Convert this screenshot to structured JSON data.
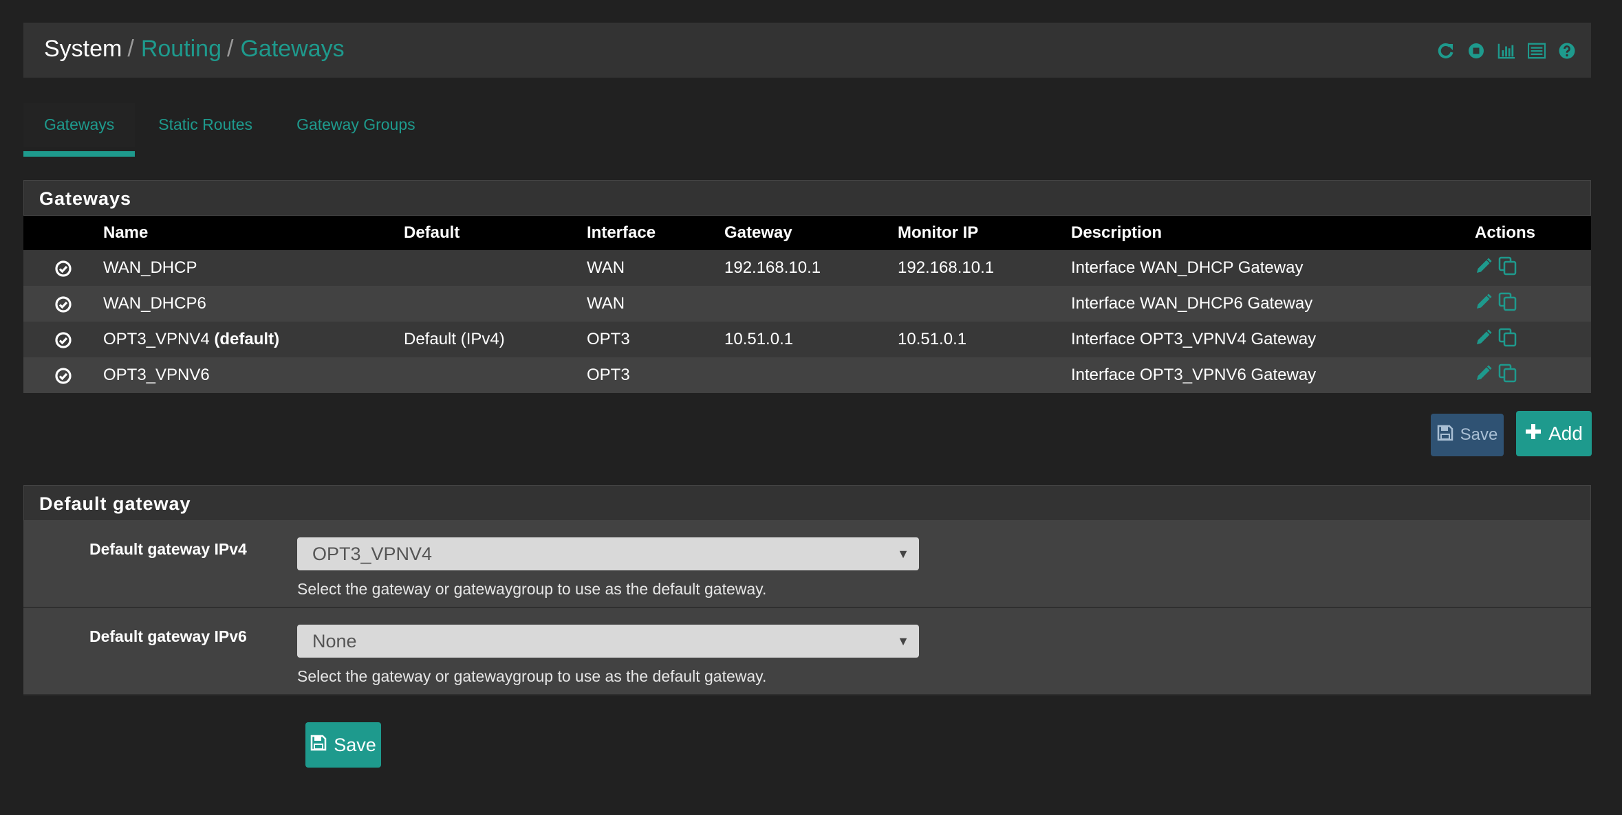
{
  "breadcrumb": {
    "items": [
      "System",
      "Routing",
      "Gateways"
    ],
    "separator": "/"
  },
  "header_icons": [
    "reload-icon",
    "stop-icon",
    "chart-icon",
    "list-icon",
    "help-icon"
  ],
  "tabs": [
    {
      "label": "Gateways",
      "active": true
    },
    {
      "label": "Static Routes",
      "active": false
    },
    {
      "label": "Gateway Groups",
      "active": false
    }
  ],
  "gateways_panel": {
    "title": "Gateways",
    "columns": [
      "",
      "Name",
      "Default",
      "Interface",
      "Gateway",
      "Monitor IP",
      "Description",
      "Actions"
    ],
    "rows": [
      {
        "name": "WAN_DHCP",
        "name_suffix": "",
        "default": "",
        "interface": "WAN",
        "gateway": "192.168.10.1",
        "monitor_ip": "192.168.10.1",
        "description": "Interface WAN_DHCP Gateway"
      },
      {
        "name": "WAN_DHCP6",
        "name_suffix": "",
        "default": "",
        "interface": "WAN",
        "gateway": "",
        "monitor_ip": "",
        "description": "Interface WAN_DHCP6 Gateway"
      },
      {
        "name": "OPT3_VPNV4",
        "name_suffix": "(default)",
        "default": "Default (IPv4)",
        "interface": "OPT3",
        "gateway": "10.51.0.1",
        "monitor_ip": "10.51.0.1",
        "description": "Interface OPT3_VPNV4 Gateway"
      },
      {
        "name": "OPT3_VPNV6",
        "name_suffix": "",
        "default": "",
        "interface": "OPT3",
        "gateway": "",
        "monitor_ip": "",
        "description": "Interface OPT3_VPNV6 Gateway"
      }
    ],
    "save_label": "Save",
    "add_label": "Add"
  },
  "default_gateway_panel": {
    "title": "Default gateway",
    "ipv4": {
      "label": "Default gateway IPv4",
      "value": "OPT3_VPNV4",
      "help": "Select the gateway or gatewaygroup to use as the default gateway."
    },
    "ipv6": {
      "label": "Default gateway IPv6",
      "value": "None",
      "help": "Select the gateway or gatewaygroup to use as the default gateway."
    }
  },
  "bottom_save_label": "Save",
  "colors": {
    "background": "#212121",
    "accent": "#1e9a8d",
    "save_disabled": "#2f5273",
    "panel": "#424242",
    "table_header": "#000000"
  }
}
